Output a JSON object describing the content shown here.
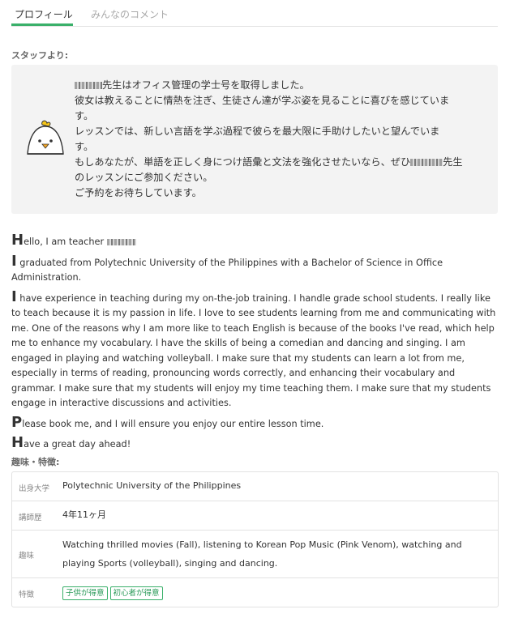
{
  "tabs": {
    "profile": "プロフィール",
    "comments": "みんなのコメント"
  },
  "staff": {
    "heading": "スタッフより:",
    "line1_suffix": "先生はオフィス管理の学士号を取得しました。",
    "line2": "彼女は教えることに情熱を注ぎ、生徒さん達が学ぶ姿を見ることに喜びを感じていま",
    "line3": "す。",
    "line4": "レッスンでは、新しい言語を学ぶ過程で彼らを最大限に手助けしたいと望んでいま",
    "line5": "す。",
    "line6_prefix": "もしあなたが、単語を正しく身につけ語彙と文法を強化させたいなら、ぜひ",
    "line6_suffix": "先生",
    "line7": "のレッスンにご参加ください。",
    "line8": "ご予約をお待ちしています。"
  },
  "intro": {
    "p1_cap": "H",
    "p1": "ello, I am teacher ",
    "p2_cap": "I",
    "p2": " graduated from Polytechnic University of the Philippines with a Bachelor of Science in Office Administration.",
    "p3_cap": "I",
    "p3": " have experience in teaching during my on-the-job training. I handle grade school students. I really like to teach because it is my passion in life. I love to see students learning from me and communicating with me. One of the reasons why I am more like to teach English is because of the books I've read, which help me to enhance my vocabulary. I have the skills of being a comedian and dancing and singing. I am engaged in playing and watching volleyball. I make sure that my students can learn a lot from me, especially in terms of reading, pronouncing words correctly, and enhancing their vocabulary and grammar. I make sure that my students will enjoy my time teaching them. I make sure that my students engage in interactive discussions and activities.",
    "p4_cap": "P",
    "p4": "lease book me, and I will ensure you enjoy our entire lesson time.",
    "p5_cap": "H",
    "p5": "ave a great day ahead!"
  },
  "details": {
    "heading": "趣味・特徴:",
    "university_label": "出身大学",
    "university": "Polytechnic University of the Philippines",
    "experience_label": "講師歴",
    "experience": "4年11ヶ月",
    "hobby_label": "趣味",
    "hobby": "Watching thrilled movies (Fall), listening to Korean Pop Music (Pink Venom), watching and playing Sports (volleyball), singing and dancing.",
    "feature_label": "特徴",
    "badges": [
      "子供が得意",
      "初心者が得意"
    ]
  },
  "colors": {
    "accent": "#3ab06a",
    "box_bg": "#f3f3f3"
  }
}
